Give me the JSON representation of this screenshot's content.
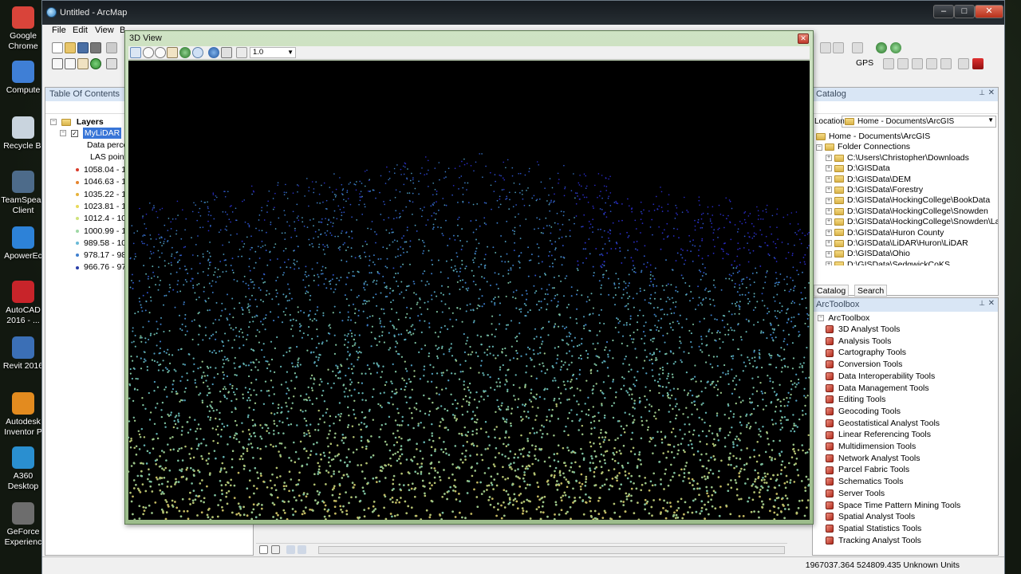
{
  "desktop": {
    "icons": [
      {
        "label": "Google Chrome",
        "color": "#d9443a"
      },
      {
        "label": "Compute",
        "color": "#3f7fd6"
      },
      {
        "label": "Recycle Bi",
        "color": "#c9d4de"
      },
      {
        "label": "TeamSpeak Client",
        "color": "#4d6b8a"
      },
      {
        "label": "ApowerEc",
        "color": "#2d82d8"
      },
      {
        "label": "AutoCAD 2016 - ...",
        "color": "#c8242a"
      },
      {
        "label": "Revit 2016",
        "color": "#3b6fb6"
      },
      {
        "label": "Autodesk Inventor P",
        "color": "#e38b1f"
      },
      {
        "label": "A360 Desktop",
        "color": "#2a8fd0"
      },
      {
        "label": "GeForce Experienc",
        "color": "#6d6d6d"
      }
    ]
  },
  "window": {
    "title": "Untitled - ArcMap",
    "min": "–",
    "max": "□",
    "close": "✕"
  },
  "menu": {
    "file": "File",
    "edit": "Edit",
    "view": "View",
    "b": "B"
  },
  "toolbar": {
    "gps": "GPS"
  },
  "toc": {
    "title": "Table Of Contents",
    "layers": "Layers",
    "layer_name": "MyLiDAR",
    "data_perce": "Data perce",
    "las_point": "LAS point",
    "classes": [
      {
        "label": "1058.04 - 1",
        "color": "#d93b2a"
      },
      {
        "label": "1046.63 - 1",
        "color": "#e5832d"
      },
      {
        "label": "1035.22 - 1",
        "color": "#e7b33a"
      },
      {
        "label": "1023.81 - 1",
        "color": "#e8d95a"
      },
      {
        "label": "1012.4 - 10",
        "color": "#cfe27a"
      },
      {
        "label": "1000.99 - 1",
        "color": "#9fd8a5"
      },
      {
        "label": "989.58 - 10",
        "color": "#69b9d6"
      },
      {
        "label": "978.17 - 98",
        "color": "#3f7fcf"
      },
      {
        "label": "966.76 - 97",
        "color": "#2a3ea8"
      }
    ]
  },
  "view3d": {
    "title": "3D View",
    "zoom": "1.0",
    "close": "✕"
  },
  "catalog": {
    "title": "Catalog",
    "location_label": "Location:",
    "location_value": "Home - Documents\\ArcGIS",
    "items": [
      "Home - Documents\\ArcGIS",
      "Folder Connections",
      "C:\\Users\\Christopher\\Downloads",
      "D:\\GISData",
      "D:\\GISData\\DEM",
      "D:\\GISData\\Forestry",
      "D:\\GISData\\HockingCollege\\BookData",
      "D:\\GISData\\HockingCollege\\Snowden",
      "D:\\GISData\\HockingCollege\\Snowden\\La",
      "D:\\GISData\\Huron County",
      "D:\\GISData\\LiDAR\\Huron\\LiDAR",
      "D:\\GISData\\Ohio",
      "D:\\GISData\\SedgwickCoKS"
    ],
    "tab_catalog": "Catalog",
    "tab_search": "Search"
  },
  "arctoolbox": {
    "title": "ArcToolbox",
    "root": "ArcToolbox",
    "tools": [
      "3D Analyst Tools",
      "Analysis Tools",
      "Cartography Tools",
      "Conversion Tools",
      "Data Interoperability Tools",
      "Data Management Tools",
      "Editing Tools",
      "Geocoding Tools",
      "Geostatistical Analyst Tools",
      "Linear Referencing Tools",
      "Multidimension Tools",
      "Network Analyst Tools",
      "Parcel Fabric Tools",
      "Schematics Tools",
      "Server Tools",
      "Space Time Pattern Mining Tools",
      "Spatial Analyst Tools",
      "Spatial Statistics Tools",
      "Tracking Analyst Tools"
    ]
  },
  "status": {
    "coords": "1967037.364  524809.435 Unknown Units"
  }
}
